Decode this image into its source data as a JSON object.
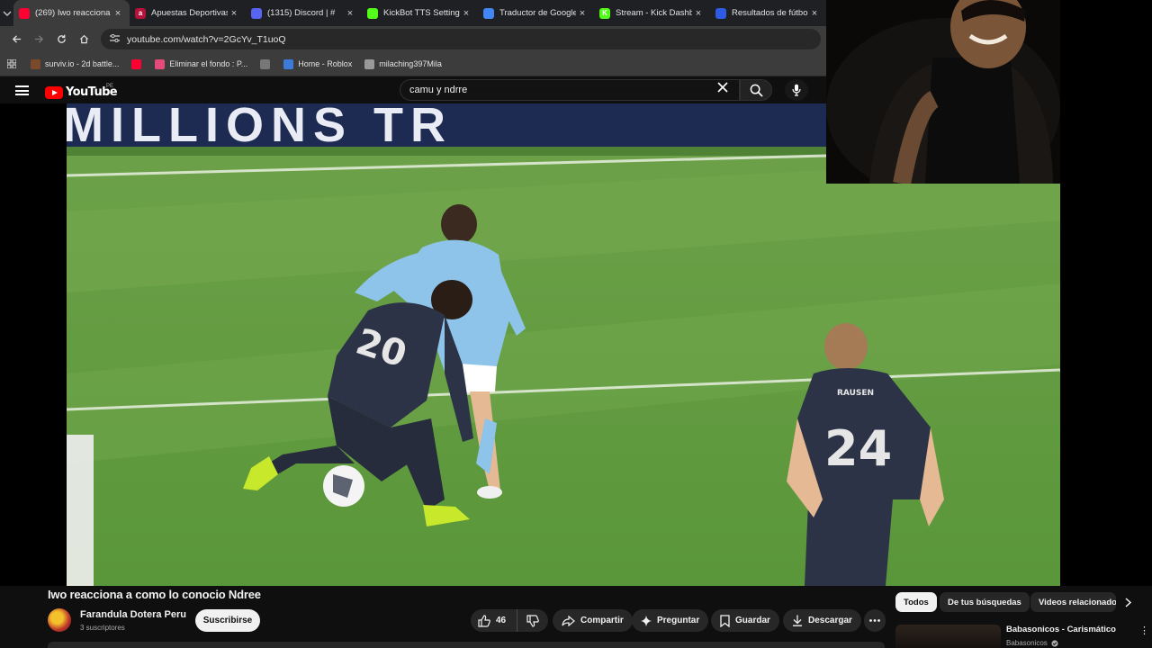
{
  "browser": {
    "tabs": [
      {
        "title": "(269) Iwo reacciona a",
        "active": true,
        "icon_color": "#ff0033"
      },
      {
        "title": "Apuestas Deportivas",
        "active": false,
        "icon_color": "#b3123b",
        "icon_letter": "a"
      },
      {
        "title": "(1315) Discord | #",
        "active": false,
        "icon_color": "#5865f2"
      },
      {
        "title": "KickBot TTS Settings",
        "active": false,
        "icon_color": "#53fc18"
      },
      {
        "title": "Traductor de Google",
        "active": false,
        "icon_color": "#4285f4"
      },
      {
        "title": "Stream - Kick Dashbo",
        "active": false,
        "icon_color": "#53fc18",
        "icon_letter": "K"
      },
      {
        "title": "Resultados de fútbol",
        "active": false,
        "icon_color": "#2d5be3"
      }
    ],
    "url": "youtube.com/watch?v=2GcYv_T1uoQ",
    "bookmarks": [
      {
        "label": "surviv.io - 2d battle...",
        "icon_color": "#7a4a2a"
      },
      {
        "label": "",
        "icon_color": "#ff0033"
      },
      {
        "label": "Eliminar el fondo : P...",
        "icon_color": "#e54b7a"
      },
      {
        "label": "",
        "icon_color": "#777777"
      },
      {
        "label": "Home - Roblox",
        "icon_color": "#3c7bd8"
      },
      {
        "label": "milaching397Mila",
        "icon_color": "#999999"
      }
    ]
  },
  "youtube": {
    "logo_text": "YouTube",
    "country": "PE",
    "search_value": "camu y ndrre",
    "video_title": "Iwo reacciona a como lo conocio Ndree",
    "channel_name": "Farandula Dotera Peru",
    "subscribers": "3 suscriptores",
    "subscribe_label": "Suscribirse",
    "like_count": "46",
    "actions": {
      "share": "Compartir",
      "ask": "Preguntar",
      "save": "Guardar",
      "download": "Descargar"
    },
    "chips": [
      "Todos",
      "De tus búsquedas",
      "Videos relacionados"
    ],
    "related": {
      "title": "Babasonicos - Carismático",
      "channel": "Babasonicos"
    },
    "video_frame": {
      "banner_text": "MILLIONS TR",
      "player_numbers": [
        "20",
        "24"
      ],
      "player_name": "RAUSEN"
    }
  },
  "colors": {
    "yt_red": "#ff0000",
    "chrome_dark": "#1f2023",
    "chrome_bar": "#3c3c3c",
    "yt_bg": "#0f0f0f"
  }
}
